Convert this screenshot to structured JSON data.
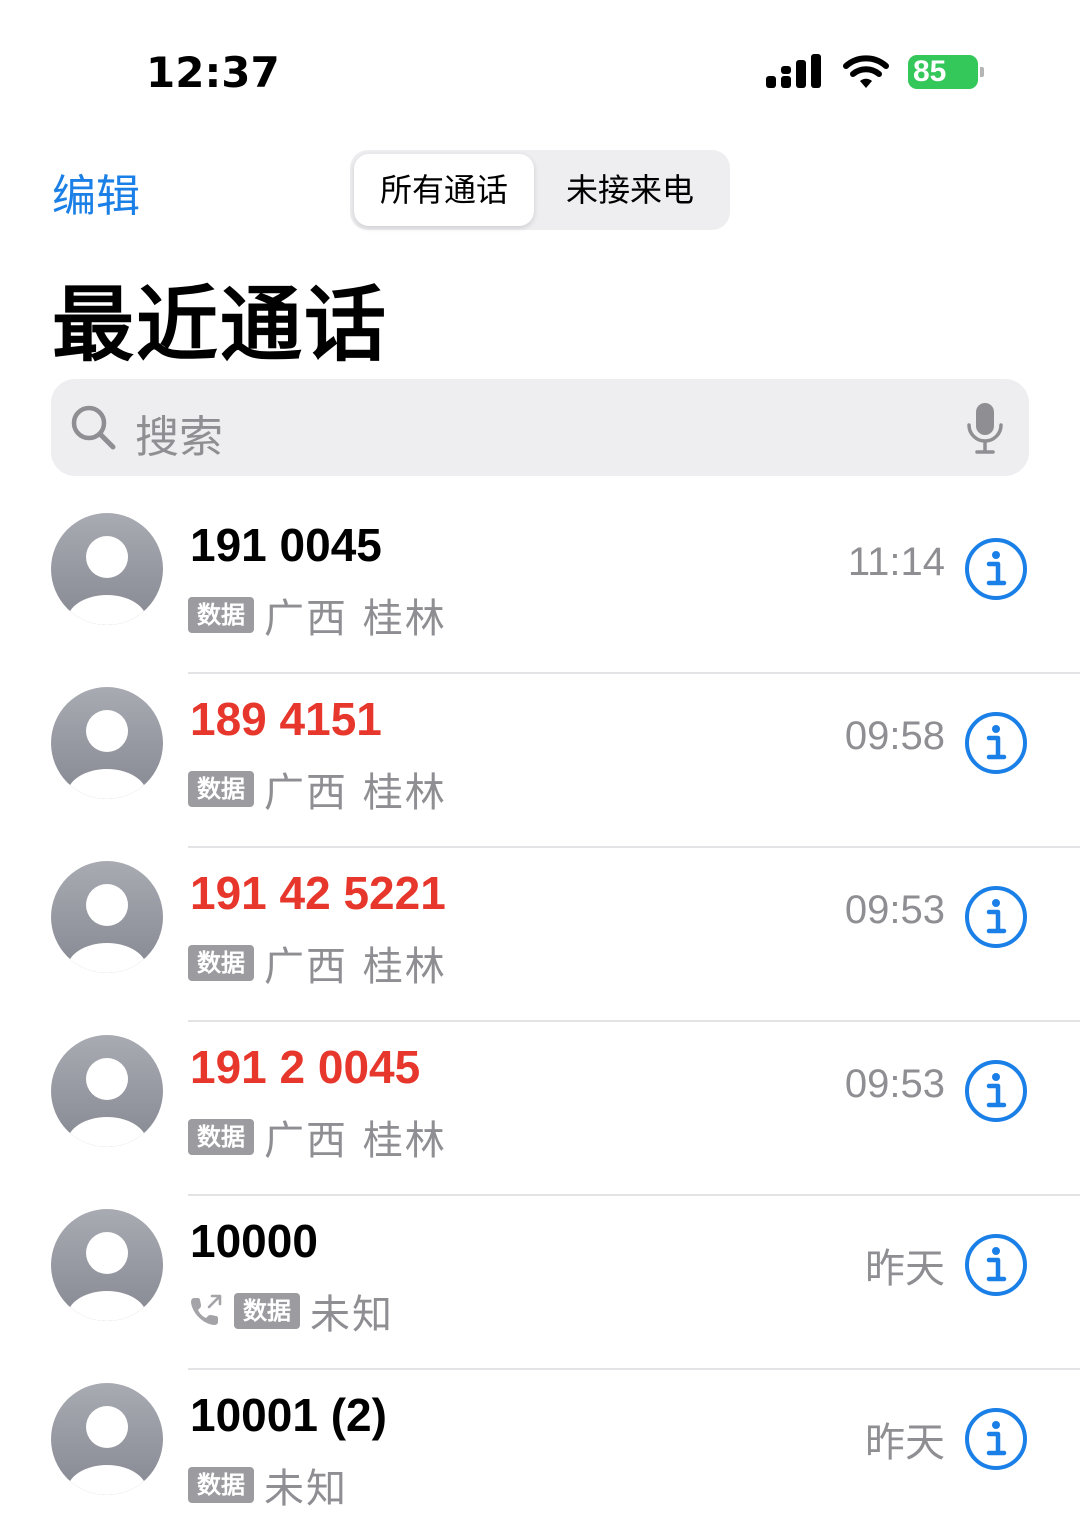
{
  "status_bar": {
    "time": "12:37",
    "battery": "85",
    "icons": [
      "cellular-signal-icon",
      "wifi-icon",
      "battery-charging-icon"
    ]
  },
  "nav": {
    "edit_label": "编辑",
    "segments": [
      {
        "label": "所有通话",
        "active": true
      },
      {
        "label": "未接来电",
        "active": false
      }
    ]
  },
  "title": "最近通话",
  "search": {
    "placeholder": "搜索",
    "icons": [
      "search-icon",
      "microphone-icon"
    ]
  },
  "calls": [
    {
      "number": "191 0045",
      "missed": false,
      "badge": "数据",
      "location": "广西 桂林",
      "time": "11:14",
      "outgoing": false
    },
    {
      "number": "189 4151",
      "missed": true,
      "badge": "数据",
      "location": "广西 桂林",
      "time": "09:58",
      "outgoing": false
    },
    {
      "number": "191 42 5221",
      "missed": true,
      "badge": "数据",
      "location": "广西 桂林",
      "time": "09:53",
      "outgoing": false
    },
    {
      "number": "191 2 0045",
      "missed": true,
      "badge": "数据",
      "location": "广西 桂林",
      "time": "09:53",
      "outgoing": false
    },
    {
      "number": "10000",
      "missed": false,
      "badge": "数据",
      "location": "未知",
      "time": "昨天",
      "outgoing": true
    },
    {
      "number": "10001 (2)",
      "missed": false,
      "badge": "数据",
      "location": "未知",
      "time": "昨天",
      "outgoing": false
    }
  ],
  "colors": {
    "accent": "#1a7fe6",
    "missed": "#e7372c",
    "secondary_text": "#8e8e93",
    "battery": "#34c759"
  }
}
